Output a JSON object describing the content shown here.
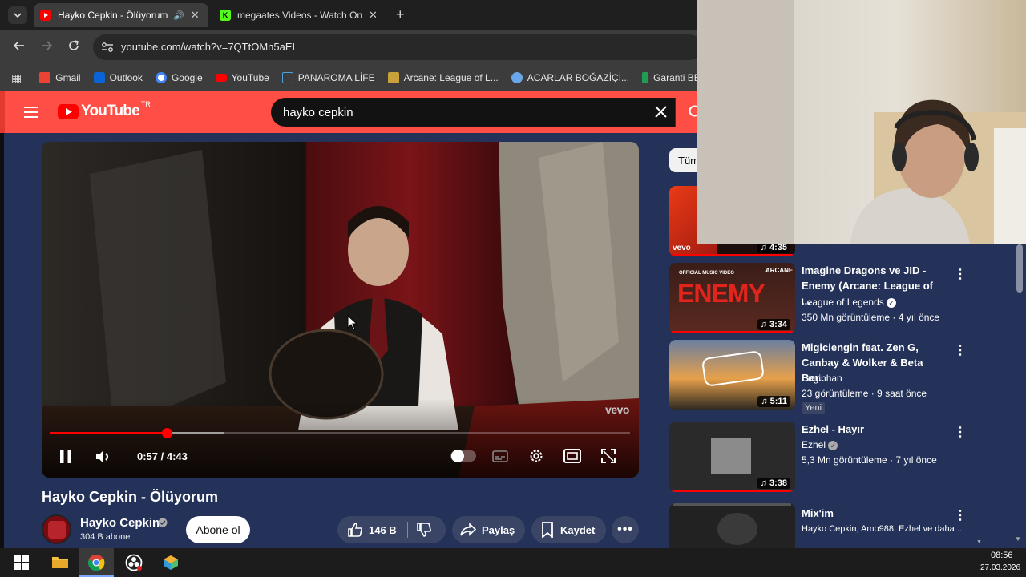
{
  "browser": {
    "tabs": [
      {
        "title": "Hayko Cepkin - Ölüyorum -",
        "active": true,
        "icon": "youtube-icon"
      },
      {
        "title": "megaates Videos - Watch On-D",
        "active": false,
        "icon": "kick-icon"
      }
    ],
    "url": "youtube.com/watch?v=7QTtOMn5aEI",
    "bookmarks": [
      "Gmail",
      "Outlook",
      "Google",
      "YouTube",
      "PANAROMA LİFE",
      "Arcane: League of L...",
      "ACARLAR BOĞAZİÇİ...",
      "Garanti BBVAhttps"
    ]
  },
  "youtube": {
    "logo": "YouTube",
    "region": "TR",
    "search_value": "hayko cepkin",
    "accent": "#ff4e45"
  },
  "player": {
    "time": "0:57 / 4:43",
    "progress": 0.2,
    "buffered": 0.3,
    "watermark": "vevo"
  },
  "video": {
    "title": "Hayko Cepkin - Ölüyorum",
    "channel": "Hayko Cepkin",
    "subscribers": "304 B abone",
    "subscribe_label": "Abone ol",
    "likes": "146 B",
    "share_label": "Paylaş",
    "save_label": "Kaydet"
  },
  "sidebar": {
    "chip": "Tüm",
    "items": [
      {
        "duration": "4:35",
        "thumb_label": "vevo"
      },
      {
        "title": "Imagine Dragons ve JID - Enemy (Arcane: League of ...",
        "channel": "League of Legends",
        "verified": true,
        "meta": "350 Mn görüntüleme · 4 yıl önce",
        "duration": "3:34",
        "thumb_label": "ENEMY",
        "badge1": "OFFICIAL MUSIC VIDEO",
        "badge2": "ARCANE"
      },
      {
        "title": "Migiciengin feat. Zen G, Canbay & Wolker & Beta Ber...",
        "channel": "Enginhan",
        "verified": false,
        "meta": "23 görüntüleme · 9 saat önce",
        "duration": "5:11",
        "new_badge": "Yeni"
      },
      {
        "title": "Ezhel - Hayır",
        "channel": "Ezhel",
        "verified": true,
        "meta": "5,3 Mn görüntüleme · 7 yıl önce",
        "duration": "3:38"
      },
      {
        "title": "Mix'im",
        "channel": "Hayko Cepkin, Amo988, Ezhel ve daha ..."
      }
    ]
  },
  "taskbar": {
    "time": "08:56",
    "date": "27.03.2026"
  }
}
